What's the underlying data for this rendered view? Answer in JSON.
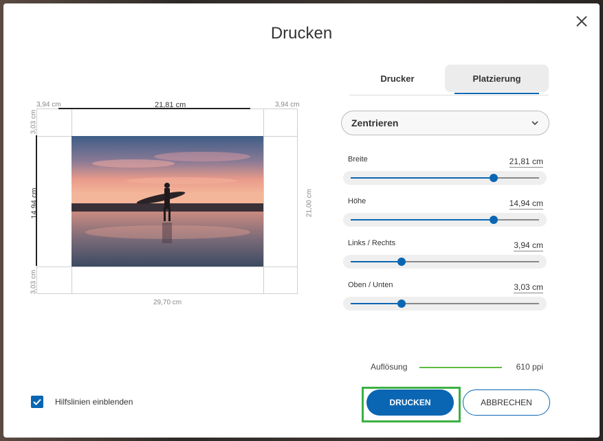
{
  "dialog": {
    "title": "Drucken"
  },
  "preview": {
    "margin_left": "3,94 cm",
    "width": "21,81 cm",
    "margin_right": "3,94 cm",
    "margin_top": "3,03 cm",
    "height": "14,94 cm",
    "margin_bottom": "3,03 cm",
    "paper_width": "29,70 cm",
    "paper_height": "21,00 cm"
  },
  "tabs": [
    {
      "label": "Drucker",
      "active": false
    },
    {
      "label": "Platzierung",
      "active": true
    }
  ],
  "placement": {
    "selected": "Zentrieren"
  },
  "sliders": [
    {
      "label": "Breite",
      "value": "21,81 cm",
      "position": 0.76
    },
    {
      "label": "Höhe",
      "value": "14,94 cm",
      "position": 0.76
    },
    {
      "label": "Links / Rechts",
      "value": "3,94 cm",
      "position": 0.27
    },
    {
      "label": "Oben / Unten",
      "value": "3,03 cm",
      "position": 0.27
    }
  ],
  "resolution": {
    "label": "Auflösung",
    "value": "610 ppi"
  },
  "guides": {
    "label": "Hilfslinien einblenden",
    "checked": true
  },
  "buttons": {
    "print": "DRUCKEN",
    "cancel": "ABBRECHEN"
  },
  "colors": {
    "accent": "#0a66b2",
    "resolution_bar": "#5dbb3f",
    "highlight": "#3cb043"
  }
}
